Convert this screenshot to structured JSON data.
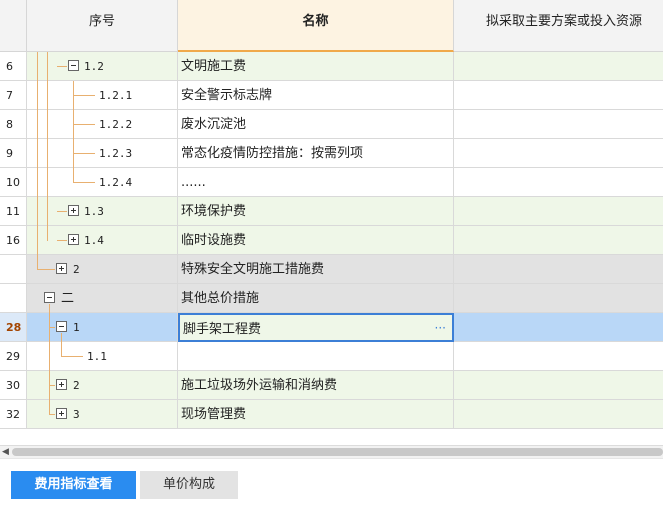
{
  "header": {
    "seq": "序号",
    "name": "名称",
    "plan": "拟采取主要方案或投入资源"
  },
  "rows": [
    {
      "idx": "6",
      "seq": "1.2",
      "name": "文明施工费",
      "more": ""
    },
    {
      "idx": "7",
      "seq": "1.2.1",
      "name": "安全警示标志牌",
      "more": ""
    },
    {
      "idx": "8",
      "seq": "1.2.2",
      "name": "废水沉淀池",
      "more": ""
    },
    {
      "idx": "9",
      "seq": "1.2.3",
      "name": "常态化疫情防控措施：按需列项",
      "more": ""
    },
    {
      "idx": "10",
      "seq": "1.2.4",
      "name": "......",
      "more": ""
    },
    {
      "idx": "11",
      "seq": "1.3",
      "name": "环境保护费",
      "more": ""
    },
    {
      "idx": "16",
      "seq": "1.4",
      "name": "临时设施费",
      "more": ""
    },
    {
      "idx": "",
      "seq": "2",
      "name": "特殊安全文明施工措施费",
      "more": ""
    },
    {
      "idx": "",
      "seq": "二",
      "name": "其他总价措施",
      "more": ""
    },
    {
      "idx": "28",
      "seq": "1",
      "name": "脚手架工程费",
      "more": "···"
    },
    {
      "idx": "29",
      "seq": "1.1",
      "name": "",
      "more": ""
    },
    {
      "idx": "30",
      "seq": "2",
      "name": "施工垃圾场外运输和消纳费",
      "more": ""
    },
    {
      "idx": "32",
      "seq": "3",
      "name": "现场管理费",
      "more": ""
    }
  ],
  "tabs": {
    "active": "费用指标查看",
    "inactive": "单价构成"
  },
  "colors": {
    "accent": "#2a8cf0",
    "selection": "#b9d7f7",
    "nameHeader": "#fdf3e2"
  }
}
